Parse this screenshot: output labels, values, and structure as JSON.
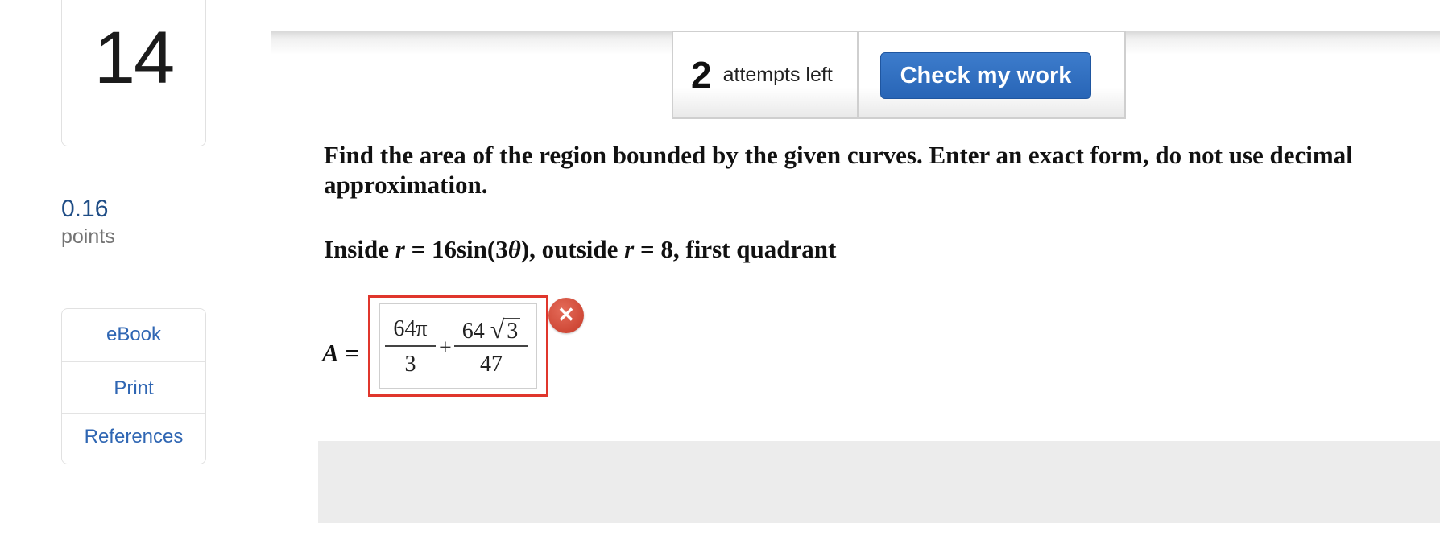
{
  "question": {
    "number": "14",
    "points_value": "0.16",
    "points_label": "points"
  },
  "resources": [
    {
      "label": "eBook"
    },
    {
      "label": "Print"
    },
    {
      "label": "References"
    }
  ],
  "toolbar": {
    "attempts_count": "2",
    "attempts_text": "attempts left",
    "check_label": "Check my work"
  },
  "prompt": {
    "instructions": "Find the area of the region bounded by the given curves. Enter an exact form, do not use decimal approximation.",
    "curves": {
      "prefix": "Inside ",
      "var1": "r",
      "eq1": " = 16sin(3",
      "theta": "θ",
      "close1": "), outside ",
      "var2": "r",
      "eq2": " = 8, first quadrant"
    }
  },
  "answer": {
    "label_var": "A",
    "label_eq": " =",
    "frac1_num": "64π",
    "frac1_den": "3",
    "plus": "+",
    "frac2_num_coeff": "64",
    "frac2_radical": "√",
    "frac2_radicand": "3",
    "frac2_den": "47",
    "status_icon": "x-icon",
    "status_color": "#d64533",
    "outline_color": "#e0362c"
  },
  "colors": {
    "accent_button": "#2a67b8",
    "link": "#2f66b3",
    "points": "#1f4d86"
  }
}
